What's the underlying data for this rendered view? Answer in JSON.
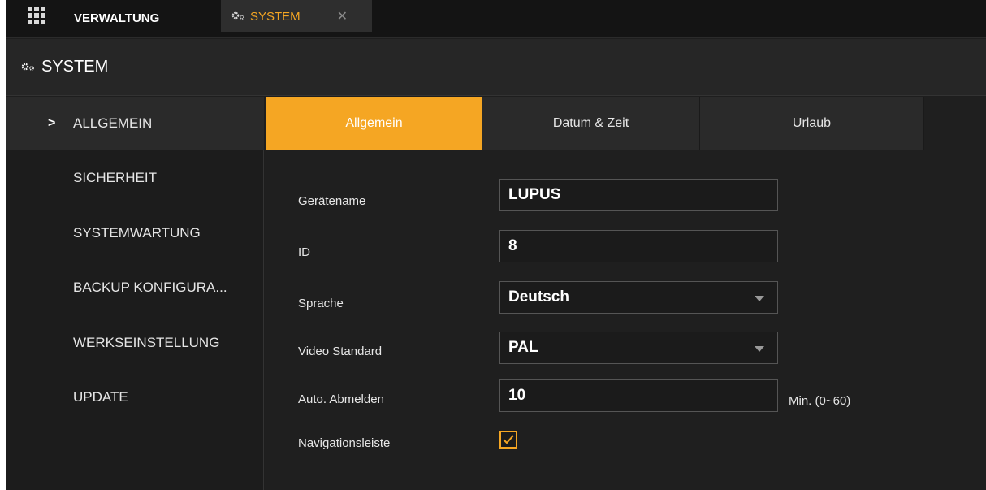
{
  "colors": {
    "accent": "#f5a623",
    "background": "#1e1e1e",
    "topbar": "#141414",
    "sidebar_active": "#2a2a2a"
  },
  "topbar": {
    "apps_icon": "grid-icon",
    "tab_verwaltung": "VERWALTUNG",
    "tab_system": "SYSTEM",
    "tab_system_icon": "gear-icon",
    "close_icon": "close-icon"
  },
  "header": {
    "title": "SYSTEM",
    "icon": "gear-icon"
  },
  "sidebar": {
    "items": [
      {
        "label": "ALLGEMEIN",
        "active": true
      },
      {
        "label": "SICHERHEIT"
      },
      {
        "label": "SYSTEMWARTUNG"
      },
      {
        "label": "BACKUP KONFIGURA..."
      },
      {
        "label": "WERKSEINSTELLUNG"
      },
      {
        "label": "UPDATE"
      }
    ]
  },
  "tabs": [
    {
      "label": "Allgemein",
      "active": true
    },
    {
      "label": "Datum & Zeit"
    },
    {
      "label": "Urlaub"
    }
  ],
  "form": {
    "geraetename": {
      "label": "Gerätename",
      "value": "LUPUS"
    },
    "id": {
      "label": "ID",
      "value": "8"
    },
    "sprache": {
      "label": "Sprache",
      "value": "Deutsch"
    },
    "video_standard": {
      "label": "Video Standard",
      "value": "PAL"
    },
    "auto_abmelden": {
      "label": "Auto. Abmelden",
      "value": "10",
      "unit": "Min. (0~60)"
    },
    "navigationsleiste": {
      "label": "Navigationsleiste",
      "checked": true
    }
  }
}
